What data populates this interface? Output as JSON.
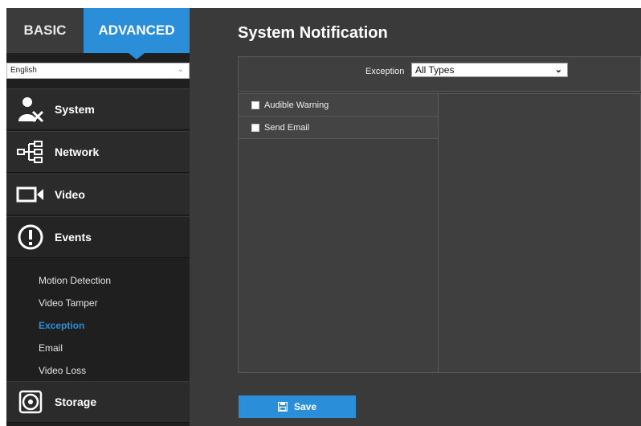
{
  "tabs": {
    "basic": "BASIC",
    "advanced": "ADVANCED"
  },
  "language": {
    "selected": "English"
  },
  "sidebar": {
    "menu": [
      {
        "label": "System",
        "icon": "system-icon"
      },
      {
        "label": "Network",
        "icon": "network-icon"
      },
      {
        "label": "Video",
        "icon": "video-camera-icon"
      },
      {
        "label": "Events",
        "icon": "exclamation-icon"
      },
      {
        "label": "Storage",
        "icon": "storage-disc-icon"
      }
    ],
    "events_submenu": [
      "Motion Detection",
      "Video Tamper",
      "Exception",
      "Email",
      "Video Loss"
    ],
    "active_submenu": "Exception"
  },
  "main": {
    "title": "System Notification",
    "exception_label": "Exception",
    "exception_value": "All Types",
    "options": [
      "Audible Warning",
      "Send Email"
    ],
    "save_label": "Save"
  },
  "colors": {
    "accent": "#2a8fd8",
    "sidebar_bg": "#1f1f1f",
    "panel_bg": "#3a3a3a"
  }
}
